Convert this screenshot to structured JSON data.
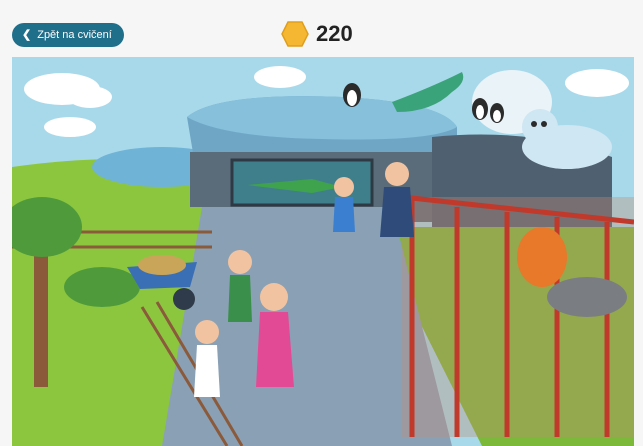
{
  "header": {
    "back_label": "Zpět na cvičení",
    "score": "220"
  },
  "colors": {
    "brand": "#1f6f8b",
    "coin": "#f5b731",
    "sky": "#9fd3e6",
    "grass": "#8cc63f"
  },
  "icons": {
    "back": "chevron-left-icon",
    "coin": "hexagon-coin-icon"
  },
  "scene": {
    "name": "zoo-illustration",
    "objects": [
      "penguins",
      "seal",
      "igloo",
      "polar-bear",
      "crocodile-tank",
      "tiger-cage",
      "wheelbarrow",
      "family",
      "zookeeper",
      "children"
    ]
  }
}
